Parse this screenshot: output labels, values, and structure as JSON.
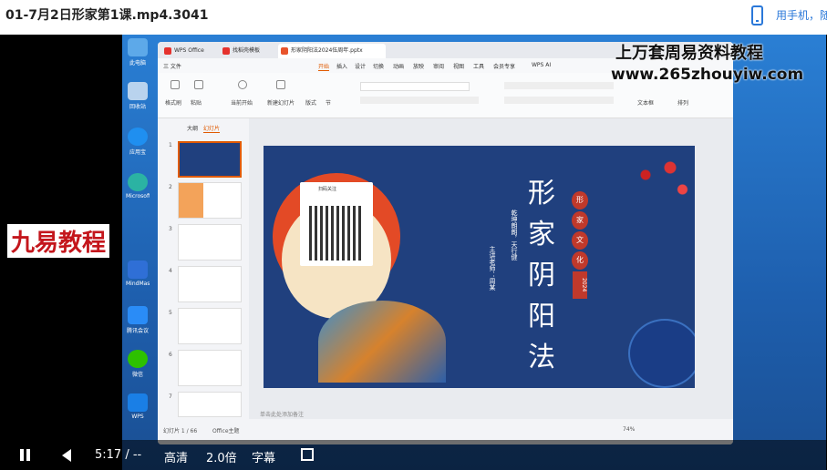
{
  "header": {
    "video_title": "01-7月2日形家第1课.mp4.3041",
    "phone_link_text": "用手机，随"
  },
  "overlay": {
    "brand_banner": "九易教程",
    "site_title": "上万套周易资料教程",
    "site_url": "www.265zhouyiw.com"
  },
  "desktop": {
    "icons": [
      "此电脑",
      "回收站",
      "应用宝",
      "Microsoft Edge",
      "",
      "MindMaster",
      "腾讯会议",
      "微信",
      "WPS"
    ]
  },
  "wps": {
    "tabs": [
      "WPS Office",
      "找稻壳模板",
      "形家阴阳法2024伍周年.pptx"
    ],
    "menus": [
      "三 文件",
      "开始",
      "插入",
      "设计",
      "切换",
      "动画",
      "放映",
      "审阅",
      "视图",
      "工具",
      "会员专享",
      "WPS AI"
    ],
    "ribbon": {
      "labels": [
        "格式刷",
        "粘贴",
        "当前开始",
        "新建幻灯片",
        "版式",
        "节",
        "文本框",
        "排列"
      ]
    },
    "pane_tabs": [
      "大纲",
      "幻灯片"
    ],
    "slide_numbers": [
      "1",
      "2",
      "3",
      "4",
      "5",
      "6",
      "7"
    ],
    "status": {
      "left": "幻灯片 1 / 66",
      "theme": "Office主题",
      "notes_placeholder": "单击此处添加备注",
      "zoom": "74%"
    },
    "slide": {
      "title_chars": [
        "形",
        "家",
        "阴",
        "阳",
        "法"
      ],
      "seal_chars": [
        "形",
        "家",
        "文",
        "化"
      ],
      "year": "2024",
      "vertical_text_1": "乾坤朗朗，天行健",
      "vertical_text_2": "主讲老师：周某",
      "qr_caption": "扫码关注"
    }
  },
  "player": {
    "time": "5:17 / --",
    "quality": "高清",
    "speed": "2.0倍",
    "subtitle": "字幕"
  }
}
